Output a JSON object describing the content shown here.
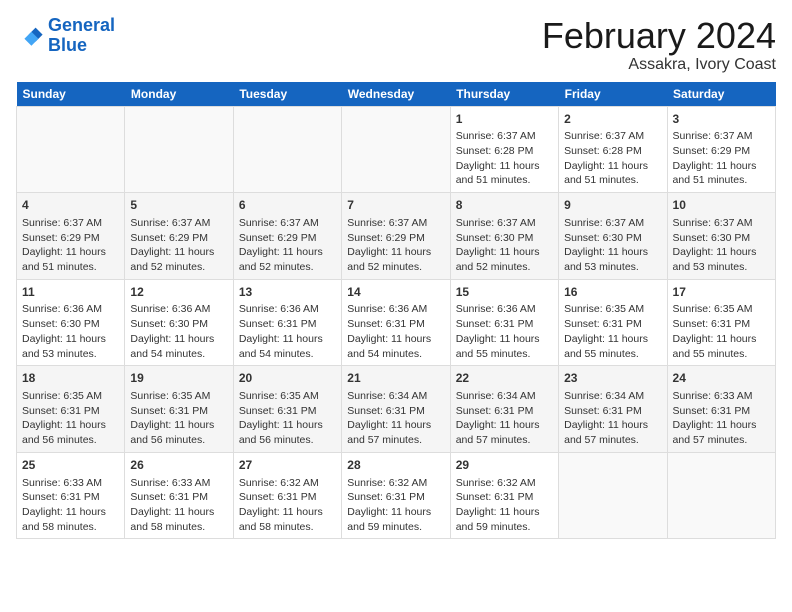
{
  "header": {
    "logo_line1": "General",
    "logo_line2": "Blue",
    "title": "February 2024",
    "subtitle": "Assakra, Ivory Coast"
  },
  "days_of_week": [
    "Sunday",
    "Monday",
    "Tuesday",
    "Wednesday",
    "Thursday",
    "Friday",
    "Saturday"
  ],
  "weeks": [
    {
      "days": [
        {
          "num": "",
          "info": ""
        },
        {
          "num": "",
          "info": ""
        },
        {
          "num": "",
          "info": ""
        },
        {
          "num": "",
          "info": ""
        },
        {
          "num": "1",
          "info": "Sunrise: 6:37 AM\nSunset: 6:28 PM\nDaylight: 11 hours and 51 minutes."
        },
        {
          "num": "2",
          "info": "Sunrise: 6:37 AM\nSunset: 6:28 PM\nDaylight: 11 hours and 51 minutes."
        },
        {
          "num": "3",
          "info": "Sunrise: 6:37 AM\nSunset: 6:29 PM\nDaylight: 11 hours and 51 minutes."
        }
      ]
    },
    {
      "days": [
        {
          "num": "4",
          "info": "Sunrise: 6:37 AM\nSunset: 6:29 PM\nDaylight: 11 hours and 51 minutes."
        },
        {
          "num": "5",
          "info": "Sunrise: 6:37 AM\nSunset: 6:29 PM\nDaylight: 11 hours and 52 minutes."
        },
        {
          "num": "6",
          "info": "Sunrise: 6:37 AM\nSunset: 6:29 PM\nDaylight: 11 hours and 52 minutes."
        },
        {
          "num": "7",
          "info": "Sunrise: 6:37 AM\nSunset: 6:29 PM\nDaylight: 11 hours and 52 minutes."
        },
        {
          "num": "8",
          "info": "Sunrise: 6:37 AM\nSunset: 6:30 PM\nDaylight: 11 hours and 52 minutes."
        },
        {
          "num": "9",
          "info": "Sunrise: 6:37 AM\nSunset: 6:30 PM\nDaylight: 11 hours and 53 minutes."
        },
        {
          "num": "10",
          "info": "Sunrise: 6:37 AM\nSunset: 6:30 PM\nDaylight: 11 hours and 53 minutes."
        }
      ]
    },
    {
      "days": [
        {
          "num": "11",
          "info": "Sunrise: 6:36 AM\nSunset: 6:30 PM\nDaylight: 11 hours and 53 minutes."
        },
        {
          "num": "12",
          "info": "Sunrise: 6:36 AM\nSunset: 6:30 PM\nDaylight: 11 hours and 54 minutes."
        },
        {
          "num": "13",
          "info": "Sunrise: 6:36 AM\nSunset: 6:31 PM\nDaylight: 11 hours and 54 minutes."
        },
        {
          "num": "14",
          "info": "Sunrise: 6:36 AM\nSunset: 6:31 PM\nDaylight: 11 hours and 54 minutes."
        },
        {
          "num": "15",
          "info": "Sunrise: 6:36 AM\nSunset: 6:31 PM\nDaylight: 11 hours and 55 minutes."
        },
        {
          "num": "16",
          "info": "Sunrise: 6:35 AM\nSunset: 6:31 PM\nDaylight: 11 hours and 55 minutes."
        },
        {
          "num": "17",
          "info": "Sunrise: 6:35 AM\nSunset: 6:31 PM\nDaylight: 11 hours and 55 minutes."
        }
      ]
    },
    {
      "days": [
        {
          "num": "18",
          "info": "Sunrise: 6:35 AM\nSunset: 6:31 PM\nDaylight: 11 hours and 56 minutes."
        },
        {
          "num": "19",
          "info": "Sunrise: 6:35 AM\nSunset: 6:31 PM\nDaylight: 11 hours and 56 minutes."
        },
        {
          "num": "20",
          "info": "Sunrise: 6:35 AM\nSunset: 6:31 PM\nDaylight: 11 hours and 56 minutes."
        },
        {
          "num": "21",
          "info": "Sunrise: 6:34 AM\nSunset: 6:31 PM\nDaylight: 11 hours and 57 minutes."
        },
        {
          "num": "22",
          "info": "Sunrise: 6:34 AM\nSunset: 6:31 PM\nDaylight: 11 hours and 57 minutes."
        },
        {
          "num": "23",
          "info": "Sunrise: 6:34 AM\nSunset: 6:31 PM\nDaylight: 11 hours and 57 minutes."
        },
        {
          "num": "24",
          "info": "Sunrise: 6:33 AM\nSunset: 6:31 PM\nDaylight: 11 hours and 57 minutes."
        }
      ]
    },
    {
      "days": [
        {
          "num": "25",
          "info": "Sunrise: 6:33 AM\nSunset: 6:31 PM\nDaylight: 11 hours and 58 minutes."
        },
        {
          "num": "26",
          "info": "Sunrise: 6:33 AM\nSunset: 6:31 PM\nDaylight: 11 hours and 58 minutes."
        },
        {
          "num": "27",
          "info": "Sunrise: 6:32 AM\nSunset: 6:31 PM\nDaylight: 11 hours and 58 minutes."
        },
        {
          "num": "28",
          "info": "Sunrise: 6:32 AM\nSunset: 6:31 PM\nDaylight: 11 hours and 59 minutes."
        },
        {
          "num": "29",
          "info": "Sunrise: 6:32 AM\nSunset: 6:31 PM\nDaylight: 11 hours and 59 minutes."
        },
        {
          "num": "",
          "info": ""
        },
        {
          "num": "",
          "info": ""
        }
      ]
    }
  ]
}
